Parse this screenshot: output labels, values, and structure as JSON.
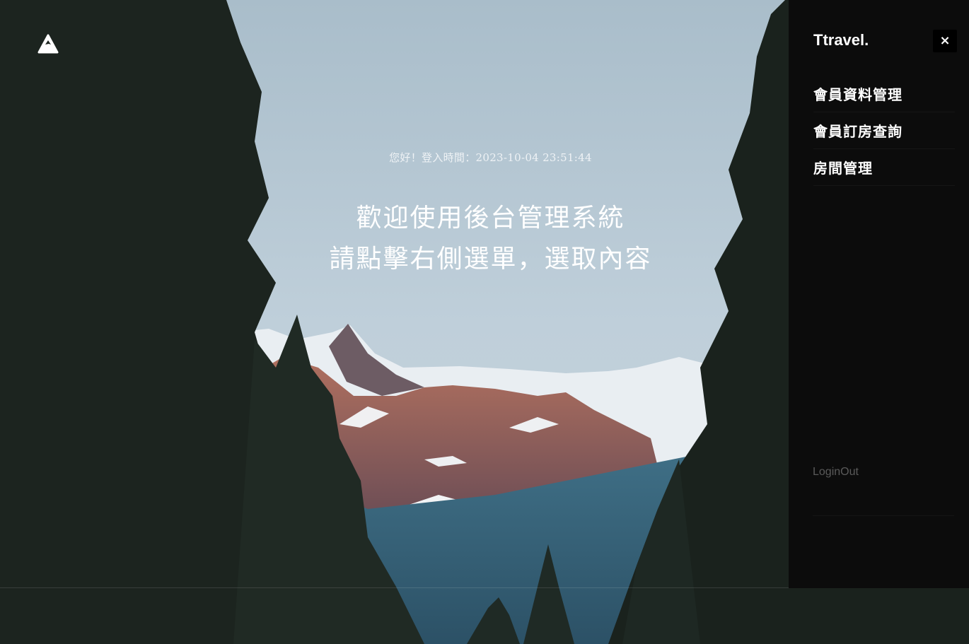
{
  "logo": {
    "icon": "mountain-logo-icon"
  },
  "hero": {
    "login_text": "您好！登入時間：2023-10-04 23:51:44",
    "title_line1": "歡迎使用後台管理系統",
    "title_line2": "請點擊右側選單，選取內容"
  },
  "panel": {
    "brand": "Ttravel.",
    "close_label": "×",
    "menu": [
      {
        "label": "會員資料管理"
      },
      {
        "label": "會員訂房查詢"
      },
      {
        "label": "房間管理"
      }
    ],
    "logout_label": "LoginOut"
  },
  "colors": {
    "panel_bg": "#0c0c0c",
    "sky": "#b8cad6",
    "text": "#ffffff",
    "logout": "#5a5a5a"
  }
}
